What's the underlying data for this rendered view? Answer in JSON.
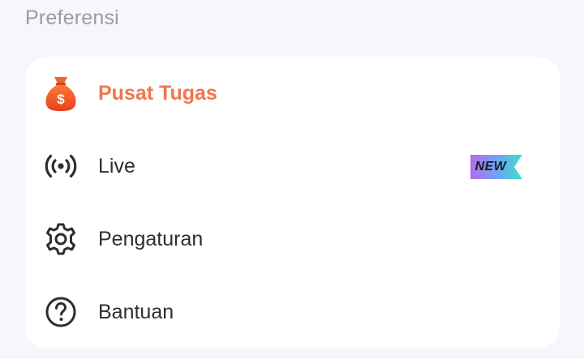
{
  "section": {
    "title": "Preferensi"
  },
  "menu": {
    "items": [
      {
        "label": "Pusat Tugas",
        "icon": "money-bag-icon"
      },
      {
        "label": "Live",
        "icon": "live-broadcast-icon",
        "badge": "NEW"
      },
      {
        "label": "Pengaturan",
        "icon": "gear-icon"
      },
      {
        "label": "Bantuan",
        "icon": "help-circle-icon"
      }
    ]
  },
  "colors": {
    "background": "#f8f6fd",
    "card": "#ffffff",
    "accent": "#f0764a",
    "text": "#2e2e30",
    "section_title": "#9b9b9f",
    "icon": "#2e2e30",
    "money_bag": "#f25a28",
    "badge_gradient": [
      "#b46cf0",
      "#3fe0c8"
    ]
  }
}
